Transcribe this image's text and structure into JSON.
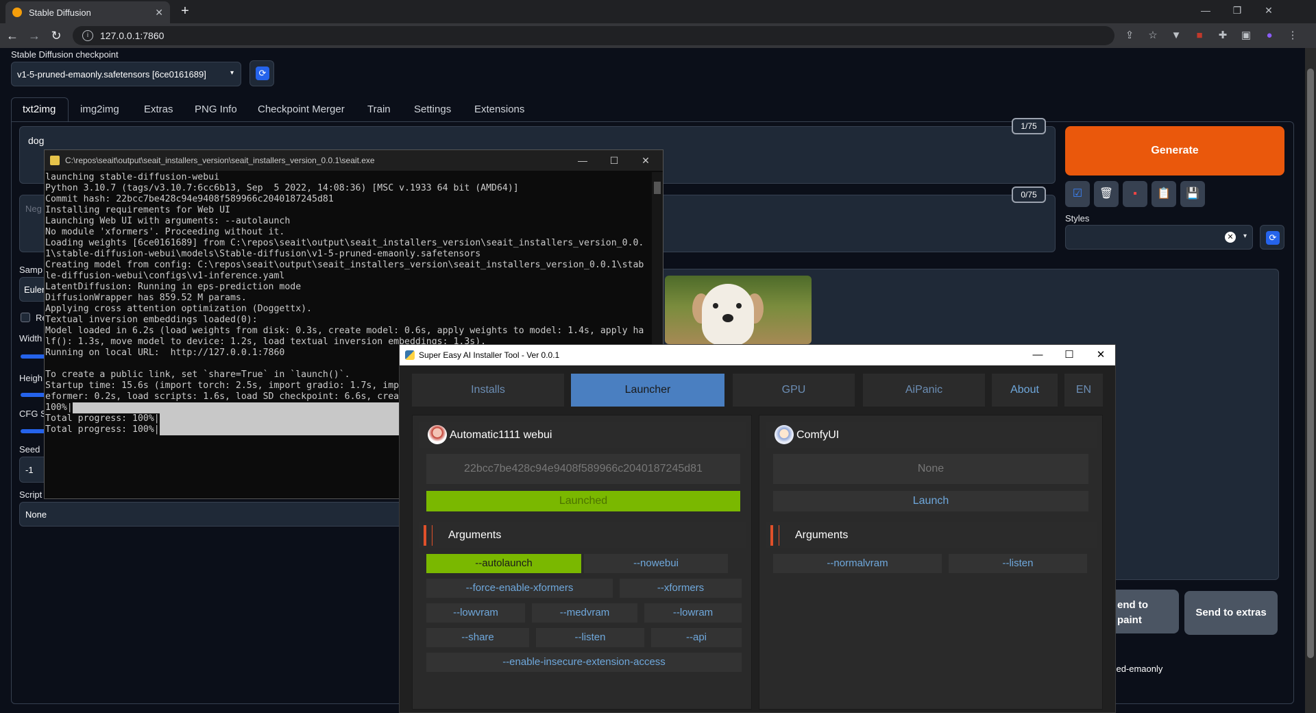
{
  "browser": {
    "tab_title": "Stable Diffusion",
    "url": "127.0.0.1:7860"
  },
  "webui": {
    "checkpoint_label": "Stable Diffusion checkpoint",
    "checkpoint_value": "v1-5-pruned-emaonly.safetensors [6ce0161689]",
    "tabs": [
      "txt2img",
      "img2img",
      "Extras",
      "PNG Info",
      "Checkpoint Merger",
      "Train",
      "Settings",
      "Extensions"
    ],
    "prompt": "dog",
    "prompt_tokens": "1/75",
    "negative_placeholder": "Neg",
    "negative_tokens": "0/75",
    "generate_label": "Generate",
    "styles_label": "Styles",
    "sampler_label": "Samp",
    "sampler_value": "Euler",
    "restore_label": "Re",
    "width_label": "Width",
    "height_label": "Heigh",
    "cfg_label": "CFG S",
    "seed_label": "Seed",
    "seed_value": "-1",
    "script_label": "Script",
    "script_value": "None",
    "send_inpaint": "end to\npaint",
    "send_extras": "Send to extras",
    "ckpt_info": "uned-emaonly"
  },
  "console": {
    "title": "C:\\repos\\seait\\output\\seait_installers_version\\seait_installers_version_0.0.1\\seait.exe",
    "lines": [
      "launching stable-diffusion-webui",
      "Python 3.10.7 (tags/v3.10.7:6cc6b13, Sep  5 2022, 14:08:36) [MSC v.1933 64 bit (AMD64)]",
      "Commit hash: 22bcc7be428c94e9408f589966c2040187245d81",
      "Installing requirements for Web UI",
      "Launching Web UI with arguments: --autolaunch",
      "No module 'xformers'. Proceeding without it.",
      "Loading weights [6ce0161689] from C:\\repos\\seait\\output\\seait_installers_version\\seait_installers_version_0.0.",
      "1\\stable-diffusion-webui\\models\\Stable-diffusion\\v1-5-pruned-emaonly.safetensors",
      "Creating model from config: C:\\repos\\seait\\output\\seait_installers_version\\seait_installers_version_0.0.1\\stab",
      "le-diffusion-webui\\configs\\v1-inference.yaml",
      "LatentDiffusion: Running in eps-prediction mode",
      "DiffusionWrapper has 859.52 M params.",
      "Applying cross attention optimization (Doggettx).",
      "Textual inversion embeddings loaded(0):",
      "Model loaded in 6.2s (load weights from disk: 0.3s, create model: 0.6s, apply weights to model: 1.4s, apply ha",
      "lf(): 1.3s, move model to device: 1.2s, load textual inversion embeddings: 1.3s).",
      "Running on local URL:  http://127.0.0.1:7860",
      "",
      "To create a public link, set `share=True` in `launch()`.",
      "Startup time: 15.6s (import torch: 2.5s, import gradio: 1.7s, imp",
      "eformer: 0.2s, load scripts: 1.6s, load SD checkpoint: 6.6s, crea"
    ],
    "progress_lines": [
      "100%|",
      "Total progress: 100%|",
      "Total progress: 100%|"
    ]
  },
  "installer": {
    "title": "Super Easy AI Installer Tool - Ver 0.0.1",
    "tabs": [
      "Installs",
      "Launcher",
      "GPU",
      "AiPanic",
      "About",
      "EN"
    ],
    "active_tab": "Launcher",
    "left": {
      "name": "Automatic1111 webui",
      "hash": "22bcc7be428c94e9408f589966c2040187245d81",
      "status": "Launched",
      "status_color": "#7ab800",
      "args_title": "Arguments",
      "args": [
        {
          "label": "--autolaunch",
          "on": true
        },
        {
          "label": "--nowebui",
          "on": false
        },
        {
          "label": "--force-enable-xformers",
          "on": false
        },
        {
          "label": "--xformers",
          "on": false
        },
        {
          "label": "--lowvram",
          "on": false
        },
        {
          "label": "--medvram",
          "on": false
        },
        {
          "label": "--lowram",
          "on": false
        },
        {
          "label": "--share",
          "on": false
        },
        {
          "label": "--listen",
          "on": false
        },
        {
          "label": "--api",
          "on": false
        },
        {
          "label": "--enable-insecure-extension-access",
          "on": false
        }
      ]
    },
    "right": {
      "name": "ComfyUI",
      "hash": "None",
      "status": "Launch",
      "args_title": "Arguments",
      "args": [
        {
          "label": "--normalvram",
          "on": false
        },
        {
          "label": "--listen",
          "on": false
        }
      ]
    }
  }
}
